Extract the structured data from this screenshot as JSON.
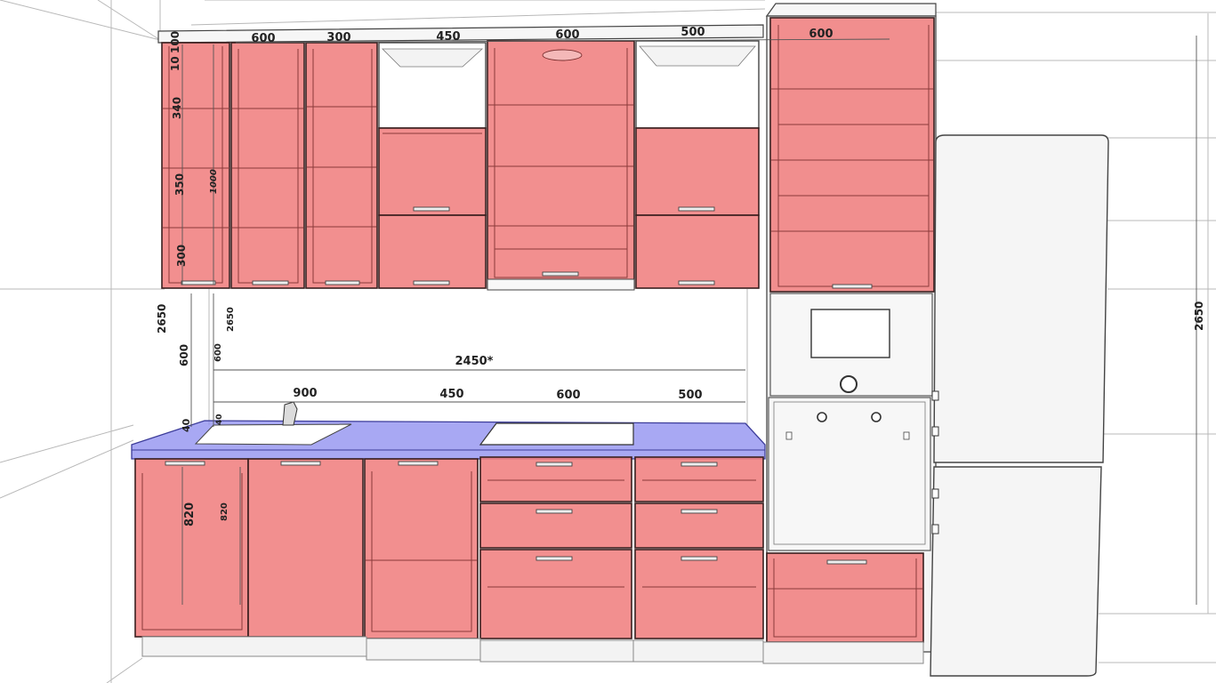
{
  "dimensions": {
    "top_widths": [
      "600",
      "300",
      "450",
      "600",
      "500",
      "600"
    ],
    "upper_vertical": [
      "10",
      "100",
      "340",
      "350",
      "300"
    ],
    "upper_total": "1000",
    "overall_height": "2650",
    "overall_height_small": "2650",
    "right_height": "2650",
    "backsplash": "600",
    "backsplash_small": "600",
    "backsplash_width": "2450*",
    "base_widths": [
      "900",
      "450",
      "600",
      "500"
    ],
    "counter_thickness": "40",
    "counter_small": "40",
    "base_height": "820",
    "base_height_small": "820"
  },
  "colors": {
    "cabinet": "#f08080",
    "countertop": "#8f8ff0",
    "appliance": "#f4f4f4"
  }
}
